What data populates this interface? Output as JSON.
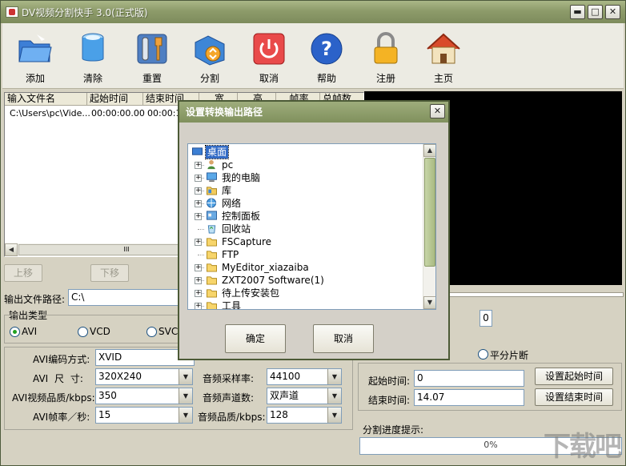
{
  "app": {
    "title": "DV视频分割快手 3.0(正式版)"
  },
  "window_controls": {
    "minimize": "▬",
    "maximize": "□",
    "close": "✕"
  },
  "toolbar": [
    {
      "label": "添加",
      "icon": "folder-icon"
    },
    {
      "label": "清除",
      "icon": "bucket-icon"
    },
    {
      "label": "重置",
      "icon": "tools-icon"
    },
    {
      "label": "分割",
      "icon": "split-icon"
    },
    {
      "label": "取消",
      "icon": "power-icon"
    },
    {
      "label": "帮助",
      "icon": "help-icon"
    },
    {
      "label": "注册",
      "icon": "lock-icon"
    },
    {
      "label": "主页",
      "icon": "home-icon"
    }
  ],
  "file_list": {
    "columns": [
      "输入文件名",
      "起始时间",
      "结束时间",
      "宽",
      "高",
      "帧率",
      "总帧数"
    ],
    "rows": [
      [
        "C:\\Users\\pc\\Vide...",
        "00:00:00.00",
        "00:00:1"
      ]
    ],
    "scroll_mark": "III"
  },
  "move_buttons": {
    "up": "上移",
    "down": "下移"
  },
  "output": {
    "path_label": "输出文件路径:",
    "path_value": "C:\\"
  },
  "output_type": {
    "label": "输出类型",
    "options": [
      "AVI",
      "VCD",
      "SVCD"
    ],
    "selected": "AVI"
  },
  "avi_settings": {
    "codec_label": "AVI编码方式:",
    "codec_value": "XVID",
    "size_label": "AVI 尺 寸:",
    "size_value": "320X240",
    "quality_label": "AVI视频品质/kbps:",
    "quality_value": "350",
    "fps_label": "AVI帧率／秒:",
    "fps_value": "15",
    "sample_label": "音频采样率:",
    "sample_value": "44100",
    "channel_label": "音频声道数:",
    "channel_value": "双声道",
    "aquality_label": "音频品质/kbps:",
    "aquality_value": "128"
  },
  "frame_counter": "0",
  "split_mode": {
    "label": "平分片断"
  },
  "time": {
    "start_label": "起始时间:",
    "start_value": "0",
    "end_label": "结束时间:",
    "end_value": "14.07",
    "set_start": "设置起始时间",
    "set_end": "设置结束时间"
  },
  "progress": {
    "label": "分割进度提示:",
    "value": "0%",
    "fraction": 0
  },
  "watermark": "下载吧",
  "dialog": {
    "title": "设置转换输出路径",
    "close": "✕",
    "tree": [
      {
        "label": "桌面",
        "expander": "",
        "icon": "desktop-icon",
        "selected": true,
        "indent": 0
      },
      {
        "label": "pc",
        "expander": "+",
        "icon": "user-icon",
        "indent": 1
      },
      {
        "label": "我的电脑",
        "expander": "+",
        "icon": "computer-icon",
        "indent": 1
      },
      {
        "label": "库",
        "expander": "+",
        "icon": "library-icon",
        "indent": 1
      },
      {
        "label": "网络",
        "expander": "+",
        "icon": "network-icon",
        "indent": 1
      },
      {
        "label": "控制面板",
        "expander": "+",
        "icon": "control-panel-icon",
        "indent": 1
      },
      {
        "label": "回收站",
        "expander": "",
        "icon": "recycle-bin-icon",
        "indent": 1
      },
      {
        "label": "FSCapture",
        "expander": "+",
        "icon": "folder-icon",
        "indent": 1
      },
      {
        "label": "FTP",
        "expander": "",
        "icon": "folder-icon",
        "indent": 1
      },
      {
        "label": "MyEditor_xiazaiba",
        "expander": "+",
        "icon": "folder-icon",
        "indent": 1
      },
      {
        "label": "ZXT2007 Software(1)",
        "expander": "+",
        "icon": "folder-icon",
        "indent": 1
      },
      {
        "label": "待上传安装包",
        "expander": "+",
        "icon": "folder-icon",
        "indent": 1
      },
      {
        "label": "工具",
        "expander": "+",
        "icon": "folder-icon",
        "indent": 1
      }
    ],
    "ok": "确定",
    "cancel": "取消"
  }
}
